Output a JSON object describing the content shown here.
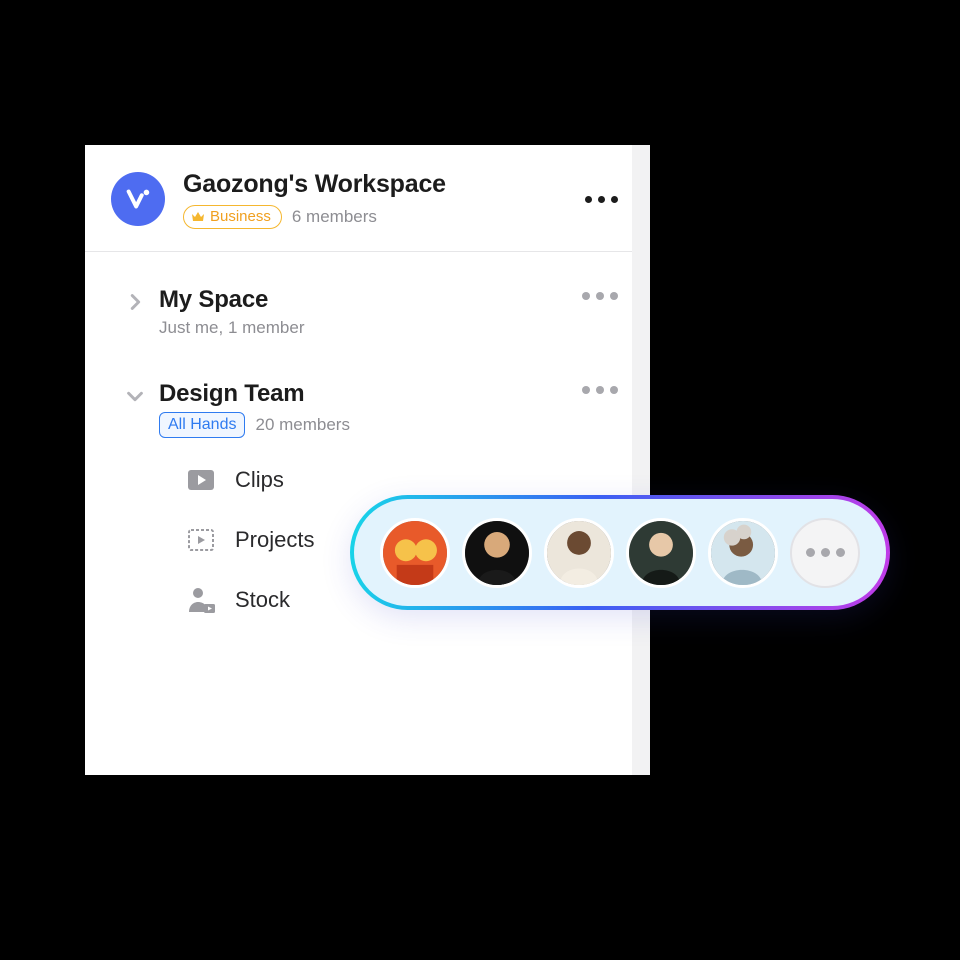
{
  "workspace": {
    "title": "Gaozong's Workspace",
    "plan_label": "Business",
    "members_text": "6 members"
  },
  "spaces": [
    {
      "title": "My Space",
      "subtitle": "Just me, 1 member",
      "collapsed": true
    },
    {
      "title": "Design Team",
      "tag": "All Hands",
      "members_text": "20 members",
      "collapsed": false,
      "items": [
        {
          "label": "Clips",
          "icon": "play"
        },
        {
          "label": "Projects",
          "icon": "film"
        },
        {
          "label": "Stock",
          "icon": "person-play"
        }
      ]
    }
  ],
  "avatar_pill": {
    "count_visible": 5,
    "has_more": true
  }
}
